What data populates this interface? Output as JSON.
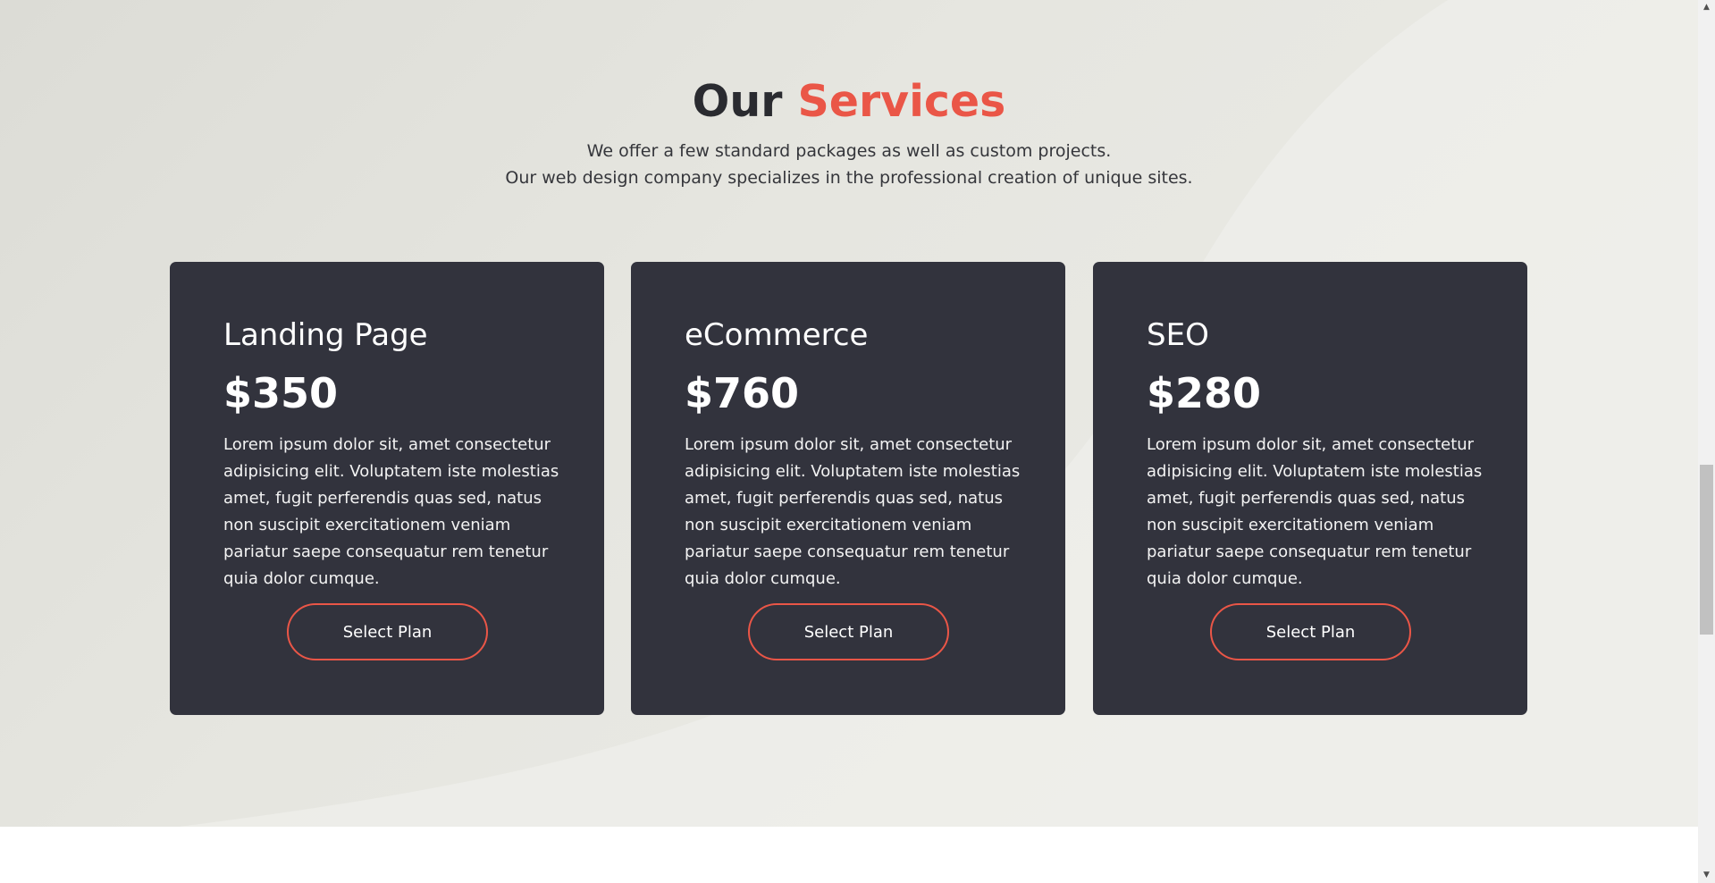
{
  "section": {
    "title_prefix": "Our",
    "title_accent": "Services",
    "subtitle_line1": "We offer a few standard packages as well as custom projects.",
    "subtitle_line2": "Our web design company specializes in the professional creation of unique sites."
  },
  "cards": [
    {
      "title": "Landing Page",
      "price": "$350",
      "description": "Lorem ipsum dolor sit, amet consectetur adipisicing elit. Voluptatem iste molestias amet, fugit perferendis quas sed, natus non suscipit exercitationem veniam pariatur saepe consequatur rem tenetur quia dolor cumque.",
      "button_label": "Select Plan"
    },
    {
      "title": "eCommerce",
      "price": "$760",
      "description": "Lorem ipsum dolor sit, amet consectetur adipisicing elit. Voluptatem iste molestias amet, fugit perferendis quas sed, natus non suscipit exercitationem veniam pariatur saepe consequatur rem tenetur quia dolor cumque.",
      "button_label": "Select Plan"
    },
    {
      "title": "SEO",
      "price": "$280",
      "description": "Lorem ipsum dolor sit, amet consectetur adipisicing elit. Voluptatem iste molestias amet, fugit perferendis quas sed, natus non suscipit exercitationem veniam pariatur saepe consequatur rem tenetur quia dolor cumque.",
      "button_label": "Select Plan"
    }
  ],
  "colors": {
    "accent": "#ea5647",
    "card_background": "#32333d",
    "heading": "#2a2b30"
  },
  "icons": {
    "scroll_up": "triangle-up-icon",
    "scroll_down": "triangle-down-icon"
  }
}
